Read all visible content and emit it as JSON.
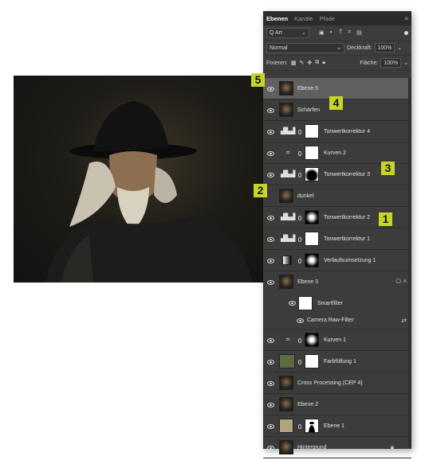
{
  "panel": {
    "tabs": [
      "Ebenen",
      "Kanäle",
      "Pfade"
    ],
    "filter": {
      "kind_label": "Q Art"
    },
    "blend": {
      "mode": "Normal",
      "opacity_label": "Deckkraft:",
      "opacity_value": "100%"
    },
    "lock": {
      "label": "Fixieren:",
      "fill_label": "Fläche:",
      "fill_value": "100%"
    }
  },
  "layers": [
    {
      "name": "Ebene 5",
      "selected": true,
      "thumb": "photo"
    },
    {
      "name": "Schärfen",
      "thumb": "photo"
    },
    {
      "name": "Tonwertkorrektur 4",
      "thumb": "levels",
      "mask": "white"
    },
    {
      "name": "Kurven 2",
      "thumb": "curves",
      "mask": "white"
    },
    {
      "name": "Tonwertkorrektur 3",
      "thumb": "levels",
      "mask": "black-white"
    },
    {
      "name": "dunkel",
      "thumb": "photo"
    },
    {
      "name": "Tonwertkorrektur 2",
      "thumb": "levels",
      "mask": "radial"
    },
    {
      "name": "Tonwertkorrektur 1",
      "thumb": "levels",
      "mask": "white"
    },
    {
      "name": "Verlaufsumsetzung 1",
      "thumb": "gradient-map",
      "mask": "radial"
    },
    {
      "name": "Ebene 3",
      "thumb": "photo",
      "smart": true
    },
    {
      "name": "Kurven 1",
      "thumb": "curves",
      "mask": "radial"
    },
    {
      "name": "Farbfüllung 1",
      "thumb": "green",
      "mask": "white"
    },
    {
      "name": "Cross Processing (CEP 4)",
      "thumb": "photo"
    },
    {
      "name": "Ebene 2",
      "thumb": "photo"
    },
    {
      "name": "Ebene 1",
      "thumb": "beige",
      "mask": "silhouette"
    },
    {
      "name": "Hintergrund",
      "thumb": "photo",
      "locked": true
    }
  ],
  "smartfilter": {
    "label": "Smartfilter",
    "filter_name": "Camera Raw-Filter"
  },
  "badges": [
    "1",
    "2",
    "3",
    "4",
    "5"
  ]
}
